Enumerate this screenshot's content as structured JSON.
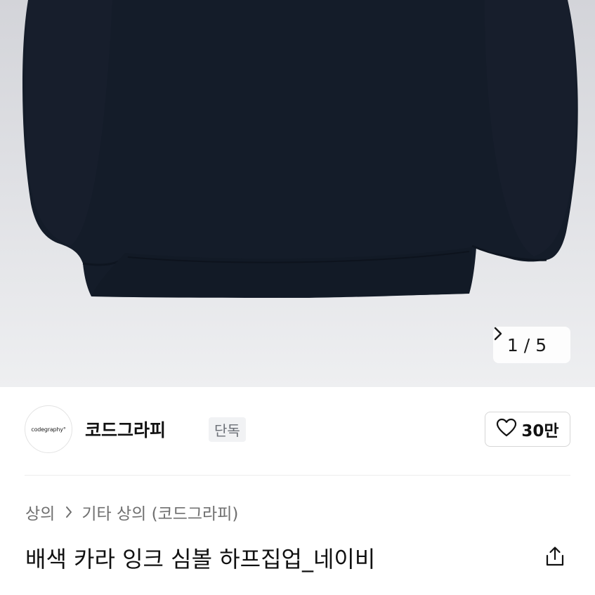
{
  "gallery": {
    "current": "1",
    "separator": "/",
    "total": "5",
    "next_icon": "chevron-right-icon",
    "background_color": "#dfe0e4",
    "product_color": "#141c29"
  },
  "brand": {
    "logo_text": "codegraphy°",
    "name": "코드그라피",
    "badge": "단독"
  },
  "like": {
    "icon": "heart-icon",
    "count": "30만"
  },
  "breadcrumb": {
    "category": "상의",
    "separator_icon": "chevron-right-icon",
    "subcategory": "기타 상의 (코드그라피)"
  },
  "product": {
    "title": "배색 카라 잉크 심볼 하프집업_네이비",
    "share_icon": "share-icon"
  }
}
